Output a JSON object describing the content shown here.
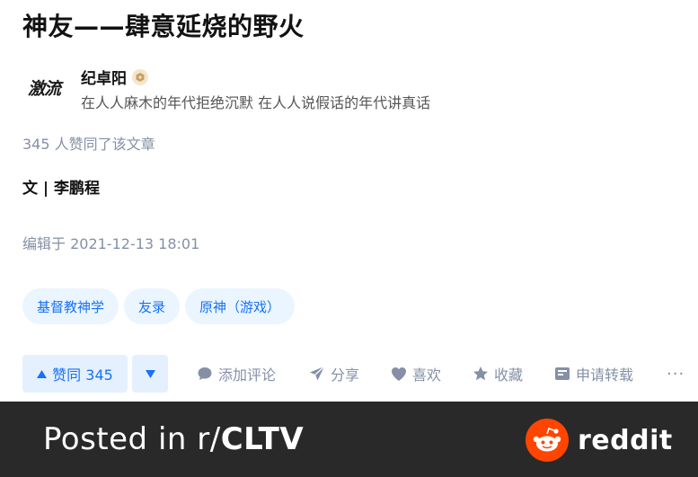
{
  "article": {
    "title": "神友——肆意延烧的野火",
    "likes_line": "345 人赞同了该文章",
    "byline": "文 | 李鹏程",
    "edited": "编辑于 2021-12-13 18:01"
  },
  "author": {
    "avatar_text": "激流",
    "name": "纪卓阳",
    "bio": "在人人麻木的年代拒绝沉默 在人人说假话的年代讲真话",
    "badge_icon": "verified-badge-icon"
  },
  "tags": [
    "基督教神学",
    "友录",
    "原神（游戏）"
  ],
  "actions": {
    "upvote_label": "赞同 345",
    "comment_label": "添加评论",
    "share_label": "分享",
    "like_label": "喜欢",
    "collect_label": "收藏",
    "repost_label": "申请转载",
    "more_label": "···"
  },
  "footer": {
    "posted_prefix": "Posted in r/",
    "subreddit": "CLTV",
    "brand": "reddit"
  },
  "colors": {
    "accent": "#1772f6",
    "muted": "#8590a6",
    "footer_bg": "#292929",
    "reddit_orange": "#ff4500"
  }
}
